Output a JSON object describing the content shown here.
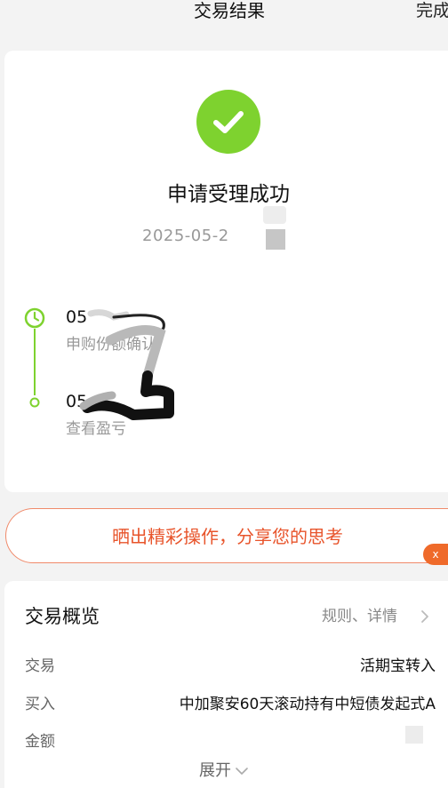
{
  "header": {
    "title": "交易结果",
    "done_label": "完成"
  },
  "result": {
    "status_title": "申请受理成功",
    "submit_time": "2025-05-2",
    "timeline": [
      {
        "title": "05",
        "subtitle": "申购份额确认"
      },
      {
        "title": "05",
        "subtitle": "查看盈亏"
      }
    ]
  },
  "share": {
    "text": "晒出精彩操作，分享您的思考",
    "close_label": "x"
  },
  "overview": {
    "title": "交易概览",
    "rules_label": "规则、详情",
    "rows": [
      {
        "label": "交易",
        "value": "活期宝转入"
      },
      {
        "label": "买入",
        "value": "中加聚安60天滚动持有中短债发起式A"
      },
      {
        "label": "金额",
        "value": ""
      }
    ],
    "expand_label": "展开"
  },
  "colors": {
    "success": "#7ed22f",
    "accent": "#e8542b",
    "close_badge": "#ef6a2a"
  }
}
